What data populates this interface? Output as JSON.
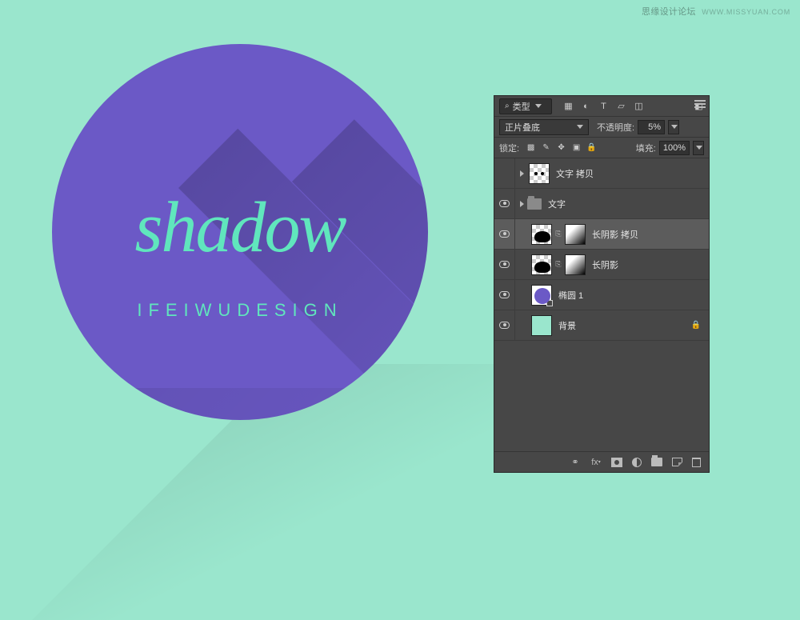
{
  "watermark": {
    "text": "思缘设计论坛",
    "url": "WWW.MISSYUAN.COM"
  },
  "artwork": {
    "script_text": "shadow",
    "subtitle": "IFEIWUDESIGN",
    "circle_color": "#6b59c6",
    "text_color": "#60e6bd",
    "bg_color": "#9ae6cd"
  },
  "panel": {
    "filter_label": "类型",
    "blend_mode": "正片叠底",
    "opacity_label": "不透明度:",
    "opacity_value": "5%",
    "lock_label": "锁定:",
    "fill_label": "填充:",
    "fill_value": "100%",
    "layers": [
      {
        "name": "文字 拷贝",
        "visible": false,
        "type": "pixel-checker",
        "selected": false
      },
      {
        "name": "文字",
        "visible": true,
        "type": "group",
        "selected": false
      },
      {
        "name": "长阴影 拷贝",
        "visible": true,
        "type": "masked-blob",
        "selected": true
      },
      {
        "name": "长阴影",
        "visible": true,
        "type": "masked-blob",
        "selected": false
      },
      {
        "name": "椭圆 1",
        "visible": true,
        "type": "purple-circle",
        "selected": false
      },
      {
        "name": "背景",
        "visible": true,
        "type": "mint-solid",
        "locked": true,
        "selected": false
      }
    ]
  }
}
